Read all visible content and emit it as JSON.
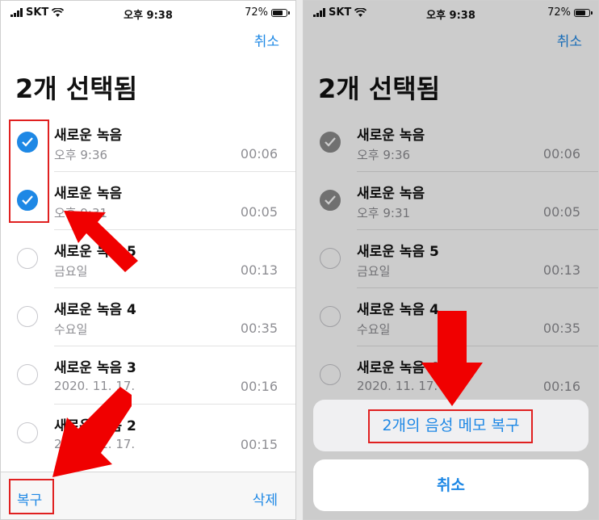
{
  "status_bar": {
    "carrier": "SKT",
    "time": "오후 9:38",
    "battery": "72%"
  },
  "header": {
    "cancel_label": "취소",
    "title": "2개 선택됨"
  },
  "left": {
    "recordings": [
      {
        "name": "새로운 녹음",
        "date": "오후 9:36",
        "duration": "00:06",
        "selected": true
      },
      {
        "name": "새로운 녹음",
        "date": "오후 9:31",
        "duration": "00:05",
        "selected": true
      },
      {
        "name": "새로운 녹음 5",
        "date": "금요일",
        "duration": "00:13",
        "selected": false
      },
      {
        "name": "새로운 녹음 4",
        "date": "수요일",
        "duration": "00:35",
        "selected": false
      },
      {
        "name": "새로운 녹음 3",
        "date": "2020. 11. 17.",
        "duration": "00:16",
        "selected": false
      },
      {
        "name": "새로운 녹음 2",
        "date": "2020. 11. 17.",
        "duration": "00:15",
        "selected": false
      }
    ],
    "toolbar": {
      "recover_label": "복구",
      "delete_label": "삭제"
    }
  },
  "right": {
    "recordings": [
      {
        "name": "새로운 녹음",
        "date": "오후 9:36",
        "duration": "00:06",
        "selected": true
      },
      {
        "name": "새로운 녹음",
        "date": "오후 9:31",
        "duration": "00:05",
        "selected": true
      },
      {
        "name": "새로운 녹음 5",
        "date": "금요일",
        "duration": "00:13",
        "selected": false
      },
      {
        "name": "새로운 녹음 4",
        "date": "수요일",
        "duration": "00:35",
        "selected": false
      },
      {
        "name": "새로운 녹음 4",
        "date": "2020. 11. 17.",
        "duration": "00:16",
        "selected": false
      }
    ],
    "action_sheet": {
      "recover_label": "2개의 음성 메모 복구",
      "cancel_label": "취소"
    }
  },
  "colors": {
    "accent": "#1e88e5",
    "annotation": "#e02020"
  }
}
